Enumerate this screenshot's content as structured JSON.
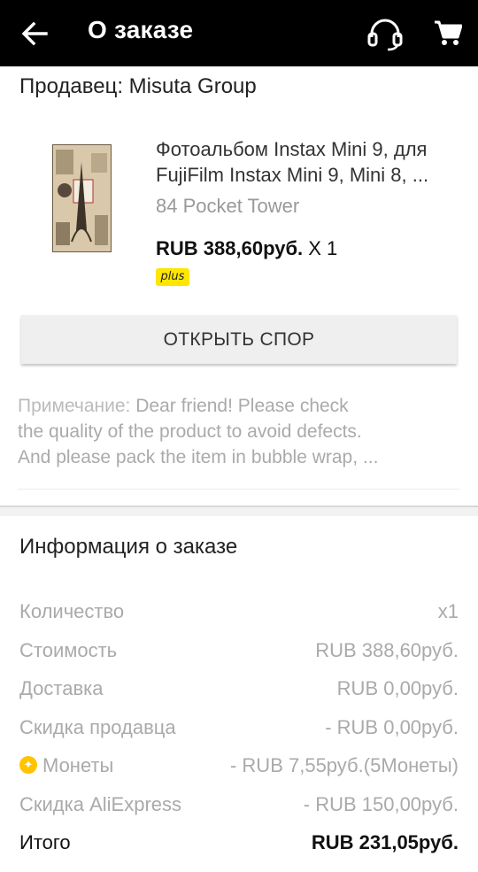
{
  "header": {
    "title": "О заказе",
    "back_icon": "arrow-left-icon",
    "support_icon": "headset-icon",
    "cart_icon": "cart-icon"
  },
  "seller": {
    "label": "Продавец: Misuta Group"
  },
  "product": {
    "title_line1": "Фотоальбом Instax Mini 9, для",
    "title_line2": "FujiFilm Instax Mini 9, Mini 8, ...",
    "sku": "84 Pocket Tower",
    "price": "RUB 388,60руб.",
    "quantity": " X 1",
    "badge": "plus"
  },
  "dispute_button": "ОТКРЫТЬ СПОР",
  "note": {
    "label": "Примечание: ",
    "line1": "Dear friend! Please check",
    "line2": "the quality of the product to avoid defects.",
    "line3": "And please pack the item in bubble wrap, ..."
  },
  "order_info": {
    "title": "Информация о заказе",
    "rows": [
      {
        "label": "Количество",
        "value": "x1"
      },
      {
        "label": "Стоимость",
        "value": "RUB 388,60руб."
      },
      {
        "label": "Доставка",
        "value": "RUB 0,00руб."
      },
      {
        "label": "Скидка продавца",
        "value": "- RUB 0,00руб."
      },
      {
        "label": "Монеты",
        "value": "- RUB 7,55руб.(5Монеты)",
        "icon": "coin-icon"
      },
      {
        "label": "Скидка AliExpress",
        "value": "- RUB 150,00руб."
      }
    ],
    "total": {
      "label": "Итого",
      "value": "RUB 231,05руб."
    }
  },
  "colors": {
    "topbar": "#000000",
    "badge": "#ffe600",
    "coin": "#ffc400"
  }
}
